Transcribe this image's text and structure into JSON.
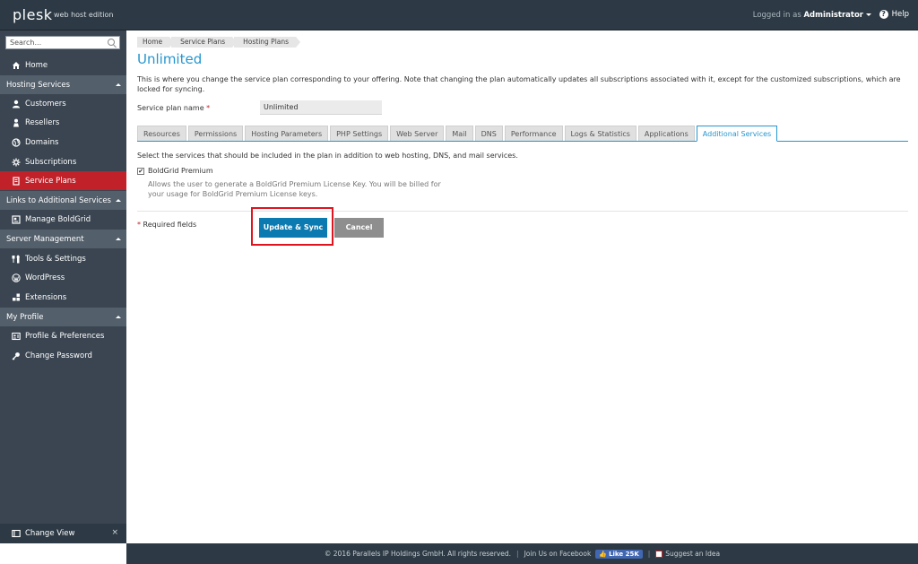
{
  "header": {
    "logo": "plesk",
    "edition": "web host edition",
    "logged_in_prefix": "Logged in as",
    "user": "Administrator",
    "help": "Help"
  },
  "sidebar": {
    "search_placeholder": "Search...",
    "home": "Home",
    "sections": [
      {
        "title": "Hosting Services",
        "items": [
          "Customers",
          "Resellers",
          "Domains",
          "Subscriptions",
          "Service Plans"
        ]
      },
      {
        "title": "Links to Additional Services",
        "items": [
          "Manage BoldGrid"
        ]
      },
      {
        "title": "Server Management",
        "items": [
          "Tools & Settings",
          "WordPress",
          "Extensions"
        ]
      },
      {
        "title": "My Profile",
        "items": [
          "Profile & Preferences",
          "Change Password"
        ]
      }
    ],
    "change_view": "Change View",
    "close": "×"
  },
  "breadcrumb": [
    "Home",
    "Service Plans",
    "Hosting Plans"
  ],
  "page": {
    "title": "Unlimited",
    "description": "This is where you change the service plan corresponding to your offering. Note that changing the plan automatically updates all subscriptions associated with it, except for the customized subscriptions, which are locked for syncing.",
    "field_label": "Service plan name",
    "required_mark": "*",
    "field_value": "Unlimited",
    "tabs": [
      "Resources",
      "Permissions",
      "Hosting Parameters",
      "PHP Settings",
      "Web Server",
      "Mail",
      "DNS",
      "Performance",
      "Logs & Statistics",
      "Applications",
      "Additional Services"
    ],
    "active_tab": "Additional Services",
    "services_note": "Select the services that should be included in the plan in addition to web hosting, DNS, and mail services.",
    "checkbox_label": "BoldGrid Premium",
    "checkbox_checked": true,
    "checkbox_desc": "Allows the user to generate a BoldGrid Premium License Key. You will be billed for your usage for BoldGrid Premium License keys.",
    "required_fields": "Required fields",
    "update_button": "Update & Sync",
    "cancel_button": "Cancel"
  },
  "footer": {
    "copyright": "© 2016 Parallels IP Holdings GmbH. All rights reserved.",
    "join": "Join Us on Facebook",
    "like": "Like 25K",
    "suggest": "Suggest an Idea"
  },
  "colors": {
    "accent": "#2596cf",
    "active_nav": "#c1222a",
    "primary_button": "#0b7ab0",
    "highlight": "#e0141e",
    "topbar": "#2d3a45",
    "sidebar": "#3a4551"
  }
}
